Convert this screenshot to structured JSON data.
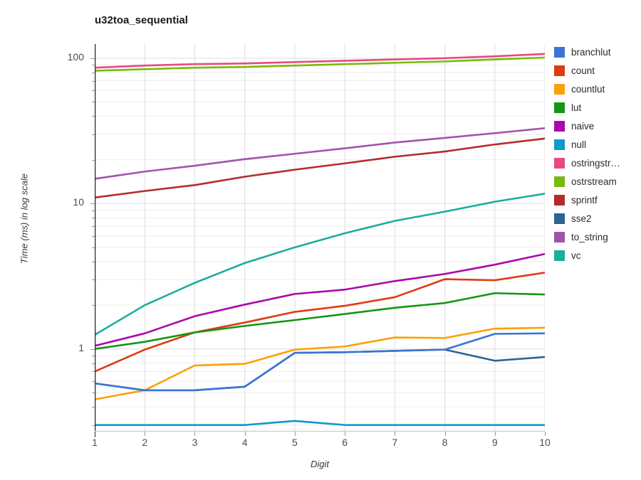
{
  "chart_data": {
    "type": "line",
    "title": "u32toa_sequential",
    "xlabel": "Digit",
    "ylabel": "Time (ms) in log scale",
    "yscale": "log",
    "grid": true,
    "legend_position": "right",
    "x": [
      1,
      2,
      3,
      4,
      5,
      6,
      7,
      8,
      9,
      10
    ],
    "xtick_labels": [
      "1",
      "2",
      "3",
      "4",
      "5",
      "6",
      "7",
      "8",
      "9",
      "10"
    ],
    "ytick_labels": [
      "100",
      "10",
      "1"
    ],
    "ytick_values": [
      100,
      10,
      1
    ],
    "ylim": [
      0.27,
      125
    ],
    "xlim": [
      1,
      10
    ],
    "series": [
      {
        "name": "branchlut",
        "color": "#3B74D4",
        "values": [
          0.58,
          0.52,
          0.52,
          0.55,
          0.94,
          0.95,
          0.97,
          0.99,
          1.27,
          1.28
        ]
      },
      {
        "name": "count",
        "color": "#DF3B13",
        "values": [
          0.7,
          0.99,
          1.3,
          1.52,
          1.8,
          1.98,
          2.27,
          3.02,
          2.97,
          3.35
        ]
      },
      {
        "name": "countlut",
        "color": "#FCA105",
        "values": [
          0.45,
          0.52,
          0.77,
          0.79,
          0.99,
          1.04,
          1.2,
          1.19,
          1.38,
          1.4
        ]
      },
      {
        "name": "lut",
        "color": "#149614",
        "values": [
          1.0,
          1.12,
          1.3,
          1.44,
          1.58,
          1.74,
          1.92,
          2.07,
          2.42,
          2.37
        ]
      },
      {
        "name": "naive",
        "color": "#AA08AA",
        "values": [
          1.05,
          1.28,
          1.68,
          2.02,
          2.39,
          2.56,
          2.93,
          3.28,
          3.8,
          4.5
        ]
      },
      {
        "name": "null",
        "color": "#0C9ACB",
        "values": [
          0.3,
          0.3,
          0.3,
          0.3,
          0.32,
          0.3,
          0.3,
          0.3,
          0.3,
          0.3
        ]
      },
      {
        "name": "ostringstr…",
        "full_name": "ostringstream",
        "color": "#E8497E",
        "values": [
          86.0,
          89.0,
          91.0,
          92.0,
          94.0,
          96.0,
          98.0,
          100.0,
          103.0,
          107.0
        ]
      },
      {
        "name": "ostrstream",
        "color": "#78BA09",
        "values": [
          82.0,
          84.0,
          86.0,
          87.0,
          89.0,
          91.0,
          93.0,
          95.0,
          98.0,
          101.0
        ]
      },
      {
        "name": "sprintf",
        "color": "#B52B2B",
        "values": [
          11.0,
          12.2,
          13.4,
          15.3,
          17.1,
          18.9,
          21.0,
          22.8,
          25.5,
          28.0
        ]
      },
      {
        "name": "sse2",
        "color": "#2D6395",
        "values": [
          0.58,
          0.52,
          0.52,
          0.55,
          0.94,
          0.95,
          0.97,
          0.99,
          0.83,
          0.88
        ]
      },
      {
        "name": "to_string",
        "color": "#A154AC",
        "values": [
          14.8,
          16.6,
          18.2,
          20.2,
          22.0,
          24.0,
          26.3,
          28.3,
          30.5,
          33.0
        ]
      },
      {
        "name": "vc",
        "color": "#1CAD9C",
        "values": [
          1.25,
          2.0,
          2.85,
          3.9,
          5.0,
          6.25,
          7.6,
          8.8,
          10.3,
          11.7
        ]
      }
    ]
  },
  "legend": {
    "items": [
      {
        "label": "branchlut",
        "color": "#3B74D4"
      },
      {
        "label": "count",
        "color": "#DF3B13"
      },
      {
        "label": "countlut",
        "color": "#FCA105"
      },
      {
        "label": "lut",
        "color": "#149614"
      },
      {
        "label": "naive",
        "color": "#AA08AA"
      },
      {
        "label": "null",
        "color": "#0C9ACB"
      },
      {
        "label": "ostringstr…",
        "color": "#E8497E"
      },
      {
        "label": "ostrstream",
        "color": "#78BA09"
      },
      {
        "label": "sprintf",
        "color": "#B52B2B"
      },
      {
        "label": "sse2",
        "color": "#2D6395"
      },
      {
        "label": "to_string",
        "color": "#A154AC"
      },
      {
        "label": "vc",
        "color": "#1CAD9C"
      }
    ]
  },
  "axes": {
    "grid_color": "#E3E3E3",
    "axis_color": "#2b2b2b",
    "tick_color": "#9a9a9a"
  }
}
